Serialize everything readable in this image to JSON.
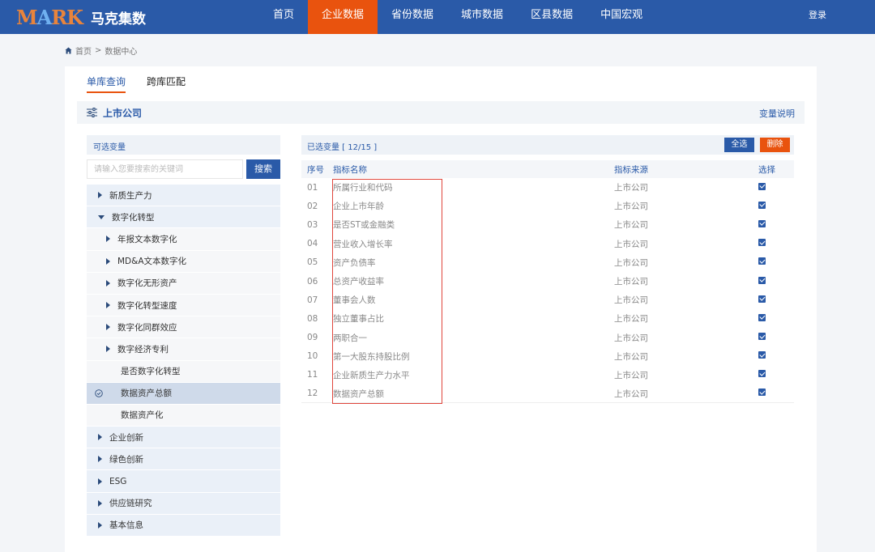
{
  "header": {
    "logo_mark_1": "M",
    "logo_mark_2": "A",
    "logo_mark_3": "RK",
    "logo_text": "马克集数",
    "nav": [
      {
        "label": "首页"
      },
      {
        "label": "企业数据"
      },
      {
        "label": "省份数据"
      },
      {
        "label": "城市数据"
      },
      {
        "label": "区县数据"
      },
      {
        "label": "中国宏观"
      }
    ],
    "active_nav": "企业数据",
    "login": "登录",
    "accent_color": "#2a5aa8",
    "active_color": "#e9530e"
  },
  "breadcrumb": {
    "home": "首页",
    "sep": ">",
    "current": "数据中心"
  },
  "tabs": [
    {
      "label": "单库查询"
    },
    {
      "label": "跨库匹配"
    }
  ],
  "active_tab": "单库查询",
  "section": {
    "title": "上市公司",
    "link": "变量说明",
    "icon": "sliders-icon"
  },
  "left": {
    "header": "可选变量",
    "search_placeholder": "请输入您要搜索的关键词",
    "search_button": "搜索",
    "tree": [
      {
        "label": "新质生产力",
        "level": 1,
        "state": "collapsed"
      },
      {
        "label": "数字化转型",
        "level": 1,
        "state": "expanded"
      },
      {
        "label": "年报文本数字化",
        "level": 2,
        "state": "collapsed"
      },
      {
        "label": "MD&A文本数字化",
        "level": 2,
        "state": "collapsed"
      },
      {
        "label": "数字化无形资产",
        "level": 2,
        "state": "collapsed"
      },
      {
        "label": "数字化转型速度",
        "level": 2,
        "state": "collapsed"
      },
      {
        "label": "数字化同群效应",
        "level": 2,
        "state": "collapsed"
      },
      {
        "label": "数字经济专利",
        "level": 2,
        "state": "collapsed"
      },
      {
        "label": "是否数字化转型",
        "level": 3,
        "state": "leaf"
      },
      {
        "label": "数据资产总额",
        "level": 3,
        "state": "selected"
      },
      {
        "label": "数据资产化",
        "level": 3,
        "state": "leaf"
      },
      {
        "label": "企业创新",
        "level": 1,
        "state": "collapsed"
      },
      {
        "label": "绿色创新",
        "level": 1,
        "state": "collapsed"
      },
      {
        "label": "ESG",
        "level": 1,
        "state": "collapsed"
      },
      {
        "label": "供应链研究",
        "level": 1,
        "state": "collapsed"
      },
      {
        "label": "基本信息",
        "level": 1,
        "state": "collapsed"
      }
    ]
  },
  "right": {
    "header": "已选变量 [ 12/15 ]",
    "select_all": "全选",
    "delete": "删除",
    "columns": {
      "no": "序号",
      "name": "指标名称",
      "source": "指标来源",
      "select": "选择"
    },
    "rows": [
      {
        "no": "01",
        "name": "所属行业和代码",
        "source": "上市公司",
        "checked": true
      },
      {
        "no": "02",
        "name": "企业上市年龄",
        "source": "上市公司",
        "checked": true
      },
      {
        "no": "03",
        "name": "是否ST或金融类",
        "source": "上市公司",
        "checked": true
      },
      {
        "no": "04",
        "name": "营业收入增长率",
        "source": "上市公司",
        "checked": true
      },
      {
        "no": "05",
        "name": "资产负债率",
        "source": "上市公司",
        "checked": true
      },
      {
        "no": "06",
        "name": "总资产收益率",
        "source": "上市公司",
        "checked": true
      },
      {
        "no": "07",
        "name": "董事会人数",
        "source": "上市公司",
        "checked": true
      },
      {
        "no": "08",
        "name": "独立董事占比",
        "source": "上市公司",
        "checked": true
      },
      {
        "no": "09",
        "name": "两职合一",
        "source": "上市公司",
        "checked": true
      },
      {
        "no": "10",
        "name": "第一大股东持股比例",
        "source": "上市公司",
        "checked": true
      },
      {
        "no": "11",
        "name": "企业新质生产力水平",
        "source": "上市公司",
        "checked": true
      },
      {
        "no": "12",
        "name": "数据资产总额",
        "source": "上市公司",
        "checked": true
      }
    ]
  }
}
